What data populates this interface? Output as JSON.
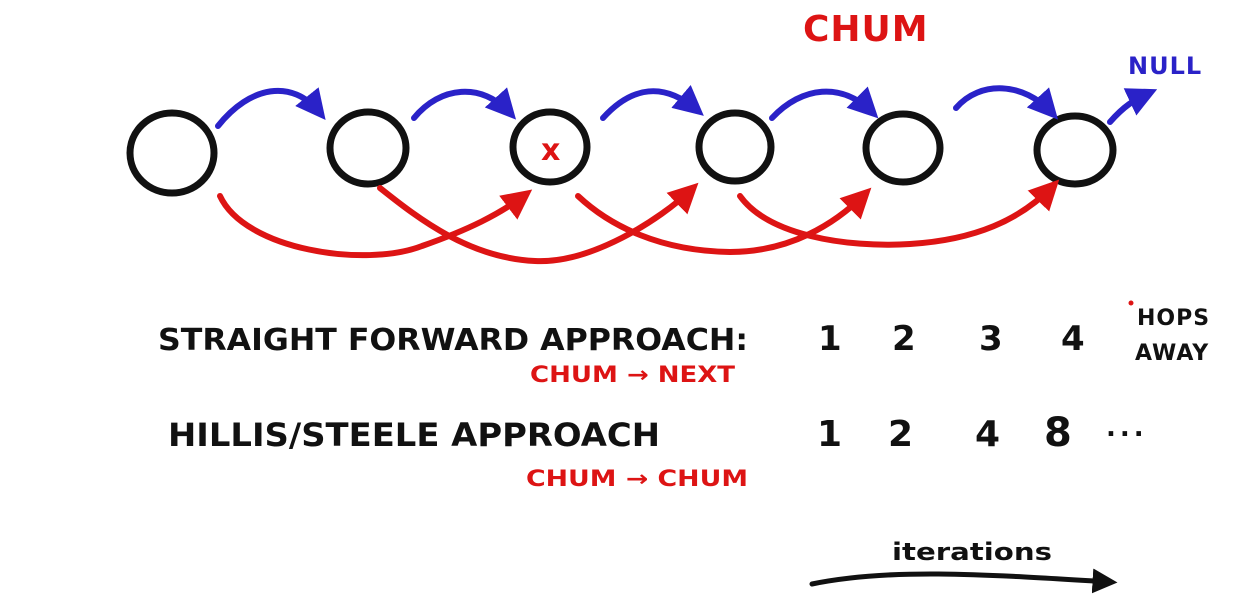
{
  "diagram": {
    "top_label": "CHUM",
    "null_label": "NULL",
    "marked_node_symbol": "x",
    "node_count": 6,
    "marked_node_index": 2
  },
  "rows": {
    "straightforward": {
      "label": "STRAIGHT FORWARD APPROACH:",
      "note": "CHUM → NEXT",
      "values": [
        "1",
        "2",
        "3",
        "4"
      ]
    },
    "hillis_steele": {
      "label": "HILLIS/STEELE APPROACH",
      "note": "CHUM → CHUM",
      "values": [
        "1",
        "2",
        "4",
        "8"
      ],
      "ellipsis": "..."
    },
    "hops_label_line1": "HOPS",
    "hops_label_line2": "AWAY"
  },
  "axis": {
    "label": "iterations"
  },
  "colors": {
    "black_ink": "#111111",
    "red_ink": "#dd1414",
    "blue_ink": "#2a22c8"
  }
}
